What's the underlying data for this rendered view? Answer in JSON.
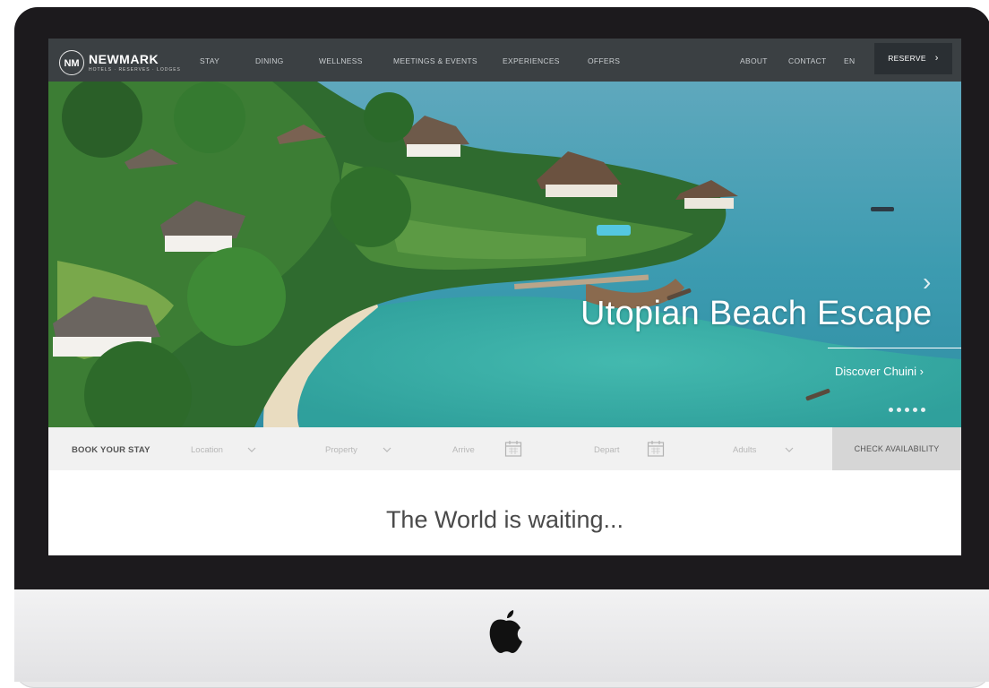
{
  "brand": {
    "mark": "NM",
    "name": "NEWMARK",
    "tagline": "HOTELS · RESERVES · LODGES"
  },
  "nav": {
    "items": [
      "STAY",
      "DINING",
      "WELLNESS",
      "MEETINGS & EVENTS",
      "EXPERIENCES",
      "OFFERS"
    ],
    "right_items": [
      "ABOUT",
      "CONTACT",
      "EN"
    ],
    "reserve_label": "RESERVE",
    "reserve_icon": "chevron-right-icon"
  },
  "hero": {
    "title": "Utopian Beach Escape",
    "link": "Discover Chuini ›",
    "slide_count": 5,
    "next_icon": "chevron-right-icon"
  },
  "booking": {
    "title": "BOOK YOUR STAY",
    "location": "Location",
    "property": "Property",
    "arrive": "Arrive",
    "depart": "Depart",
    "adults": "Adults",
    "check_label": "CHECK AVAILABILITY"
  },
  "tagline": "The World is waiting...",
  "colors": {
    "nav_bg": "#3b4043",
    "reserve_bg": "#2a2f33",
    "sea": "#3d9bb0",
    "lagoon": "#3fb6a8",
    "booking_bg": "#f1f1f1",
    "check_bg": "#d6d6d6"
  }
}
